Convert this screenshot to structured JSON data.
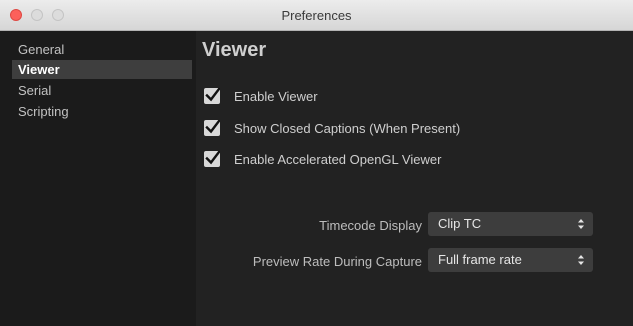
{
  "window": {
    "title": "Preferences"
  },
  "sidebar": {
    "items": [
      {
        "label": "General",
        "selected": false
      },
      {
        "label": "Viewer",
        "selected": true
      },
      {
        "label": "Serial",
        "selected": false
      },
      {
        "label": "Scripting",
        "selected": false
      }
    ]
  },
  "main": {
    "heading": "Viewer",
    "checkboxes": [
      {
        "label": "Enable Viewer",
        "checked": true
      },
      {
        "label": "Show Closed Captions (When Present)",
        "checked": true
      },
      {
        "label": "Enable Accelerated OpenGL Viewer",
        "checked": true
      }
    ],
    "fields": [
      {
        "label": "Timecode Display",
        "value": "Clip TC"
      },
      {
        "label": "Preview Rate During Capture",
        "value": "Full frame rate"
      }
    ]
  },
  "colors": {
    "close_button": "#fc605b",
    "sidebar_bg": "#1b1b1b",
    "main_bg": "#222222",
    "selection_bg": "#3e3e3e",
    "checkbox_fill": "#d8d8d8",
    "dropdown_bg": "#3d3d3d"
  },
  "icons": [
    "close-icon",
    "minimize-icon",
    "zoom-icon",
    "checkmark-icon",
    "dropdown-arrows-icon"
  ]
}
